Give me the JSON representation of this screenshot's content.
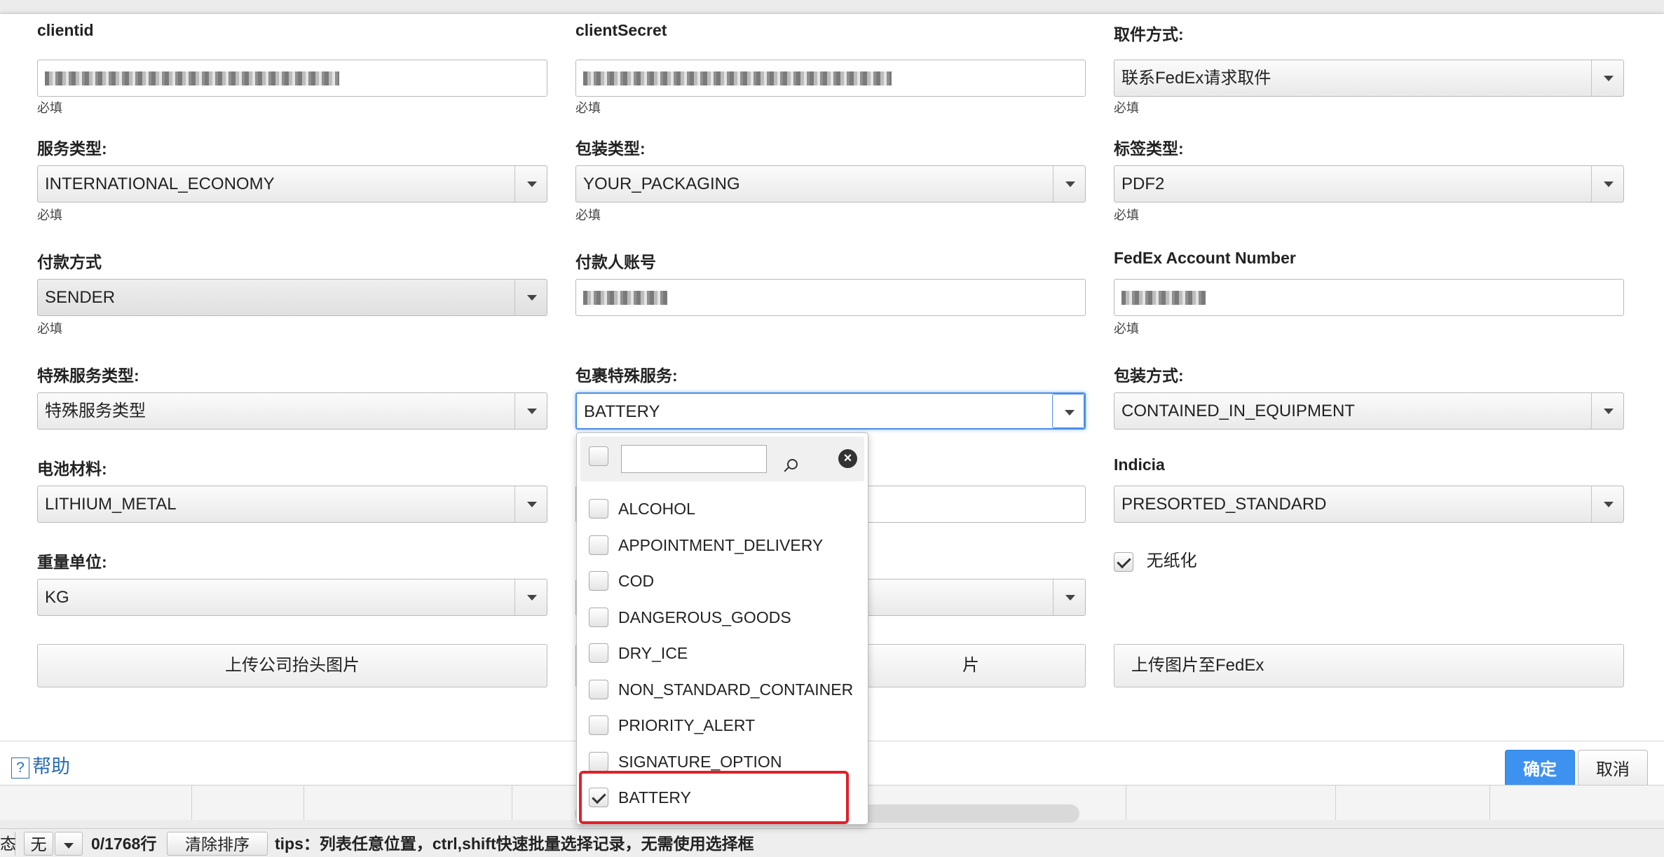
{
  "form": {
    "clientid": {
      "label": "clientid",
      "required": "必填"
    },
    "clientSecret": {
      "label": "clientSecret",
      "required": "必填"
    },
    "pickup": {
      "label": "取件方式:",
      "value": "联系FedEx请求取件",
      "required": "必填"
    },
    "service_type": {
      "label": "服务类型:",
      "value": "INTERNATIONAL_ECONOMY",
      "required": "必填"
    },
    "packaging_type": {
      "label": "包装类型:",
      "value": "YOUR_PACKAGING",
      "required": "必填"
    },
    "label_type": {
      "label": "标签类型:",
      "value": "PDF2",
      "required": "必填"
    },
    "payment": {
      "label": "付款方式",
      "value": "SENDER",
      "required": "必填"
    },
    "payer_account": {
      "label": "付款人账号"
    },
    "fedex_account": {
      "label": "FedEx Account Number",
      "required": "必填"
    },
    "special_service": {
      "label": "特殊服务类型:",
      "value": "特殊服务类型"
    },
    "package_special": {
      "label": "包裹特殊服务:",
      "value": "BATTERY"
    },
    "packing_method": {
      "label": "包装方式:",
      "value": "CONTAINED_IN_EQUIPMENT"
    },
    "battery_material": {
      "label": "电池材料:",
      "value": "LITHIUM_METAL"
    },
    "indicia": {
      "label": "Indicia",
      "value": "PRESORTED_STANDARD"
    },
    "weight_unit": {
      "label": "重量单位:",
      "value": "KG"
    },
    "paperless": {
      "label": "无纸化",
      "checked": true
    },
    "upload_logo": "上传公司抬头图片",
    "upload_middle_partial": "片",
    "upload_fedex": "上传图片至FedEx"
  },
  "dropdown": {
    "search_value": "",
    "options": [
      {
        "label": "ALCOHOL",
        "checked": false
      },
      {
        "label": "APPOINTMENT_DELIVERY",
        "checked": false
      },
      {
        "label": "COD",
        "checked": false
      },
      {
        "label": "DANGEROUS_GOODS",
        "checked": false
      },
      {
        "label": "DRY_ICE",
        "checked": false
      },
      {
        "label": "NON_STANDARD_CONTAINER",
        "checked": false
      },
      {
        "label": "PRIORITY_ALERT",
        "checked": false
      },
      {
        "label": "SIGNATURE_OPTION",
        "checked": false
      },
      {
        "label": "BATTERY",
        "checked": true
      }
    ]
  },
  "footer": {
    "help": "帮助",
    "help_icon": "?",
    "confirm": "确定",
    "cancel": "取消"
  },
  "statusbar": {
    "left_fragment": "态",
    "select_value": "无",
    "row_count": "0/1768行",
    "clear_sort": "清除排序",
    "tips": "tips：列表任意位置，ctrl,shift快速批量选择记录，无需使用选择框"
  },
  "colors": {
    "accent": "#3d92ef",
    "highlight_border": "#e0202a",
    "link": "#2a6db5"
  }
}
